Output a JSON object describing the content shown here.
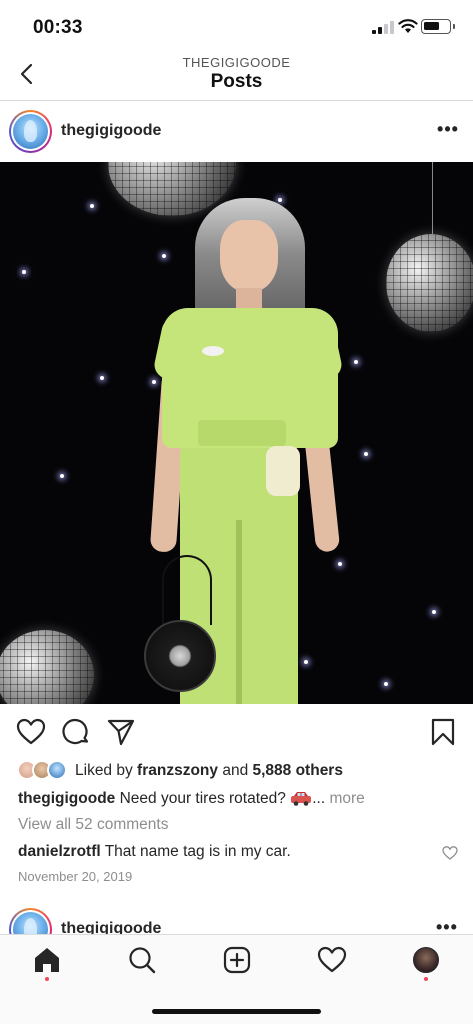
{
  "status_bar": {
    "time": "00:33"
  },
  "nav": {
    "subtitle": "THEGIGIGOODE",
    "title": "Posts"
  },
  "post": {
    "username": "thegigigoode",
    "likes": {
      "prefix": "Liked by ",
      "liker": "franzszony",
      "connector": " and ",
      "others": "5,888 others"
    },
    "caption": {
      "username": "thegigigoode",
      "text": " Need your tires rotated? ",
      "ellipsis": "... ",
      "more_label": "more"
    },
    "view_comments": "View all 52 comments",
    "comment": {
      "username": "danielzrotfl",
      "text": " That name tag is in my car."
    },
    "date": "November 20, 2019"
  },
  "next_post": {
    "username": "thegigigoode"
  },
  "icons": {
    "back": "chevron-left-icon",
    "more": "more-horizontal-icon",
    "like": "heart-icon",
    "comment": "comment-bubble-icon",
    "share": "paper-plane-icon",
    "save": "bookmark-icon",
    "home": "home-icon",
    "search": "search-icon",
    "new_post": "plus-square-icon",
    "activity": "heart-icon",
    "profile": "profile-avatar-icon",
    "car": "car-emoji-icon"
  },
  "colors": {
    "text": "#262626",
    "secondary_text": "#8e8e8e",
    "notification_dot": "#ed4956",
    "divider": "#dbdbdb"
  }
}
